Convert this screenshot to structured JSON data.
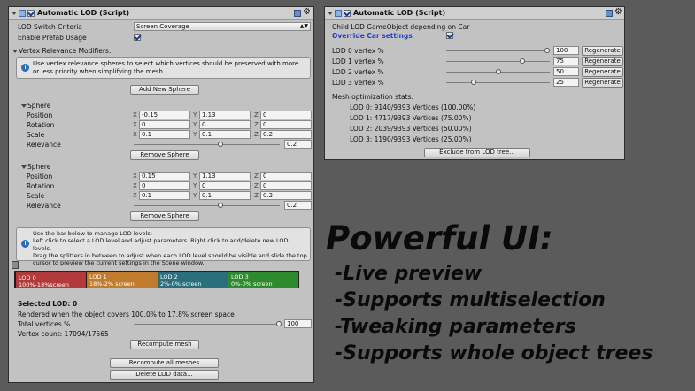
{
  "left": {
    "header_title": "Automatic LOD (Script)",
    "switch_criteria_label": "LOD Switch Criteria",
    "switch_criteria_value": "Screen Coverage",
    "enable_prefab_label": "Enable Prefab Usage",
    "vertex_relevance_label": "Vertex Relevance Modifiers:",
    "vertex_help": "Use vertex relevance spheres to select which vertices should be preserved with more or less priority when simplifying the mesh.",
    "add_sphere": "Add New Sphere",
    "spheres": [
      {
        "title": "Sphere",
        "position": [
          "-0.15",
          "1.13",
          "0"
        ],
        "rotation": [
          "0",
          "0",
          "0"
        ],
        "scale": [
          "0.1",
          "0.1",
          "0.2"
        ],
        "relevance": "0.2",
        "relevance_fraction": 0.6
      },
      {
        "title": "Sphere",
        "position": [
          "0.15",
          "1.13",
          "0"
        ],
        "rotation": [
          "0",
          "0",
          "0"
        ],
        "scale": [
          "0.1",
          "0.1",
          "0.2"
        ],
        "relevance": "0.2",
        "relevance_fraction": 0.6
      }
    ],
    "row_labels": {
      "position": "Position",
      "rotation": "Rotation",
      "scale": "Scale",
      "relevance": "Relevance"
    },
    "axis": {
      "x": "X",
      "y": "Y",
      "z": "Z"
    },
    "remove_sphere": "Remove Sphere",
    "lod_help": "Use the bar below to manage LOD levels:\nLeft click to select a LOD level and adjust parameters. Right click to add/delete new LOD levels.\nDrag the splitters in between to adjust when each LOD level should be visible and slide the top cursor to preview the current settings in the Scene window.",
    "lod_bar": [
      {
        "name": "LOD 0",
        "range": "100%-18%screen",
        "color": "#b23a3a"
      },
      {
        "name": "LOD 1",
        "range": "18%-2% screen",
        "color": "#c07c2c"
      },
      {
        "name": "LOD 2",
        "range": "2%-0% screen",
        "color": "#2a6f7c"
      },
      {
        "name": "LOD 3",
        "range": "0%-0% screen",
        "color": "#2d8a2d"
      }
    ],
    "selected_lod": "Selected LOD: 0",
    "rendered_when": "Rendered when the object covers 100.0% to 17.8% screen space",
    "total_vertices_label": "Total vertices %",
    "total_vertices_value": "100",
    "vertex_count": "Vertex count: 17094/17565",
    "recompute_mesh": "Recompute mesh",
    "recompute_all": "Recompute all meshes",
    "delete_lod": "Delete LOD data..."
  },
  "right": {
    "header_title": "Automatic LOD (Script)",
    "child_lod_label": "Child LOD GameObject depending on Car",
    "override_label": "Override Car settings",
    "lods": [
      {
        "label": "LOD 0 vertex %",
        "value": "100",
        "fraction": 1.0
      },
      {
        "label": "LOD 1 vertex %",
        "value": "75",
        "fraction": 0.75
      },
      {
        "label": "LOD 2 vertex %",
        "value": "50",
        "fraction": 0.5
      },
      {
        "label": "LOD 3 vertex %",
        "value": "25",
        "fraction": 0.25
      }
    ],
    "regenerate": "Regenerate",
    "stats_label": "Mesh optimization stats:",
    "stats": [
      "LOD 0: 9140/9393 Vertices (100.00%)",
      "LOD 1: 4717/9393 Vertices (75.00%)",
      "LOD 2: 2039/9393 Vertices (50.00%)",
      "LOD 3: 1190/9393 Vertices (25.00%)"
    ],
    "exclude": "Exclude from LOD tree..."
  },
  "promo": {
    "title": "Powerful UI:",
    "bullets": [
      "-Live preview",
      "-Supports multiselection",
      "-Tweaking parameters",
      "-Supports whole object trees"
    ]
  },
  "colors": {
    "panel": "#c2c2c2",
    "background": "#5b5b5b",
    "override_text": "#1f3fc6",
    "info": "#2d6cb8"
  }
}
